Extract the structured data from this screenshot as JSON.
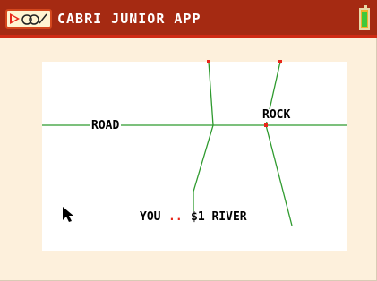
{
  "titlebar": {
    "title": "CABRI JUNIOR APP",
    "app_icon": "cabri-app-icon",
    "battery_icon": "battery-icon"
  },
  "canvas": {
    "labels": {
      "road": "ROAD",
      "rock": "ROCK",
      "you": "YOU",
      "dots": "..",
      "river": "$1 RIVER"
    },
    "cursor_icon": "arrow-cursor-icon"
  },
  "colors": {
    "title_bar": "#a52a12",
    "background": "#fdf0dc",
    "lines": "#2e9a2e",
    "points": "#e8261a"
  }
}
